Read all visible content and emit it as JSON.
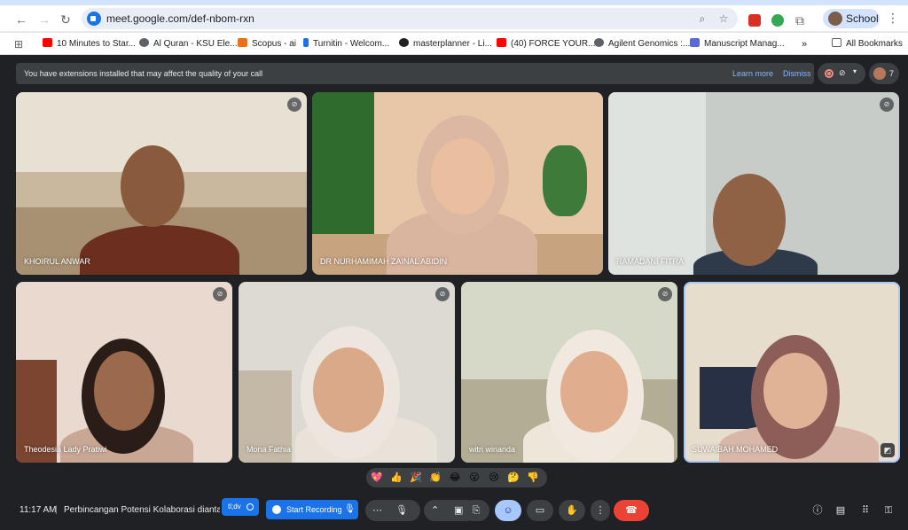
{
  "browser": {
    "url": "meet.google.com/def-nbom-rxn",
    "profile_label": "School",
    "bookmarks": [
      {
        "label": "10 Minutes to Star...",
        "color": "#ff0000"
      },
      {
        "label": "Al Quran - KSU Ele...",
        "color": "#5f6368"
      },
      {
        "label": "Scopus - ai",
        "color": "#e9711c"
      },
      {
        "label": "Turnitin - Welcom...",
        "color": "#1a73e8"
      },
      {
        "label": "masterplanner - Li...",
        "color": "#202124"
      },
      {
        "label": "(40) FORCE YOUR...",
        "color": "#ff0000"
      },
      {
        "label": "Agilent Genomics :...",
        "color": "#5f6368"
      },
      {
        "label": "Manuscript Manag...",
        "color": "#5b6bd6"
      }
    ],
    "all_bookmarks": "All Bookmarks",
    "more_bookmarks": "»"
  },
  "meet": {
    "notice": {
      "text": "You have extensions installed that may affect the quality of your call",
      "learn_more": "Learn more",
      "dismiss": "Dismiss"
    },
    "participant_count": "7",
    "tiles": [
      {
        "name": "KHOIRUL ANWAR",
        "muted": true,
        "bg": "#c9b89e"
      },
      {
        "name": "DR NURHAMIMAH ZAINAL ABIDIN",
        "muted": false,
        "bg": "#e8c7a8"
      },
      {
        "name": "RAMADANI FITRA",
        "muted": true,
        "bg": "#c7ccc8"
      },
      {
        "name": "Theodesia Lady Pratiwi",
        "muted": true,
        "bg": "#e9d9cf"
      },
      {
        "name": "Mona Fathia",
        "muted": true,
        "bg": "#dcdad2"
      },
      {
        "name": "witri winanda",
        "muted": true,
        "bg": "#d6d8c8"
      },
      {
        "name": "SUWAIBAH MOHAMED",
        "muted": false,
        "bg": "#e6ddcd"
      }
    ],
    "reactions": [
      "💖",
      "👍",
      "🎉",
      "👏",
      "😂",
      "😮",
      "😢",
      "🤔",
      "👎"
    ],
    "bottom": {
      "time": "11:17 AM",
      "separator": "|",
      "meeting_title": "Perbincangan Potensi Kolaborasi diantara",
      "tl_badge": "tl;dv",
      "start_recording": "Start Recording"
    }
  }
}
